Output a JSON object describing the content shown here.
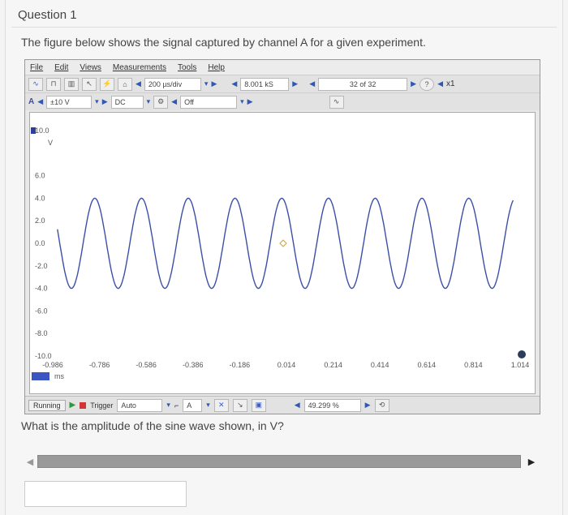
{
  "question": {
    "title": "Question 1",
    "intro": "The figure below shows the signal captured by channel A for a given experiment.",
    "ask": "What is the amplitude of the sine wave shown, in V?",
    "answer_value": ""
  },
  "app": {
    "menu": [
      "File",
      "Edit",
      "Views",
      "Measurements",
      "Tools",
      "Help"
    ],
    "toolbar1": {
      "timebase": "200 µs/div",
      "samples": "8.001 kS",
      "buffer": "32 of 32",
      "zoom": "x1"
    },
    "toolbar2": {
      "channel": "A",
      "range": "±10 V",
      "coupling": "DC",
      "filter": "Off"
    },
    "status": {
      "running": "Running",
      "trigger_label": "Trigger",
      "trigger_mode": "Auto",
      "trigger_channel": "A",
      "pretrigger": "49.299 %"
    }
  },
  "plot": {
    "y_unit": "V",
    "x_unit": "ms",
    "y_ticks": [
      "10.0",
      "6.0",
      "4.0",
      "2.0",
      "0.0",
      "-2.0",
      "-4.0",
      "-6.0",
      "-8.0",
      "-10.0"
    ],
    "x_ticks": [
      "-0.986",
      "-0.786",
      "-0.586",
      "-0.386",
      "-0.186",
      "0.014",
      "0.214",
      "0.414",
      "0.614",
      "0.814",
      "1.014"
    ],
    "x_range": [
      -0.986,
      1.014
    ],
    "y_range": [
      -10,
      10
    ],
    "amplitude": 4.0,
    "period_ms": 0.2,
    "phase_ref_ms": -0.056,
    "trace_color": "#3b4fa8"
  }
}
